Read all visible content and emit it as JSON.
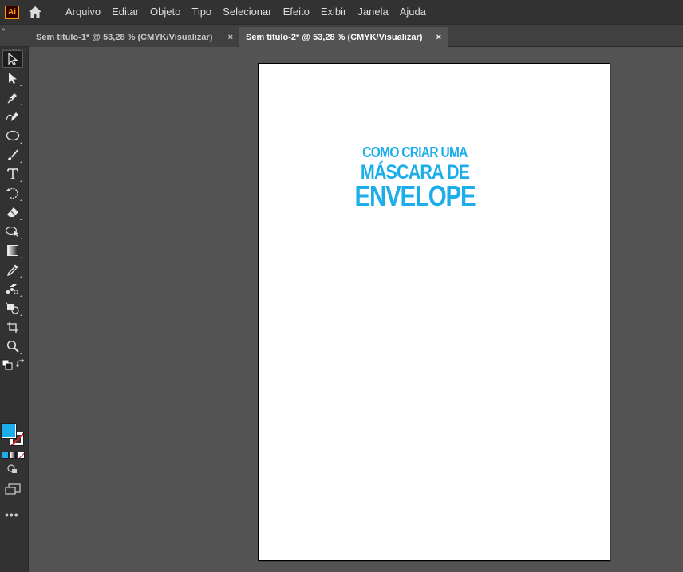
{
  "app": {
    "logo_text": "Ai"
  },
  "menu": {
    "items": [
      "Arquivo",
      "Editar",
      "Objeto",
      "Tipo",
      "Selecionar",
      "Efeito",
      "Exibir",
      "Janela",
      "Ajuda"
    ]
  },
  "tabs": [
    {
      "label": "Sem título-1* @ 53,28 % (CMYK/Visualizar)",
      "close": "×",
      "active": false
    },
    {
      "label": "Sem título-2* @ 53,28 % (CMYK/Visualizar)",
      "close": "×",
      "active": true
    }
  ],
  "toolbar": {
    "collapse_glyph": "»",
    "more_glyph": "•••",
    "fill_color": "#1cadeb",
    "stroke_color": "none"
  },
  "artboard": {
    "lines": [
      "COMO CRIAR UMA",
      "MÁSCARA DE",
      "ENVELOPE"
    ],
    "text_color": "#1cadeb"
  }
}
